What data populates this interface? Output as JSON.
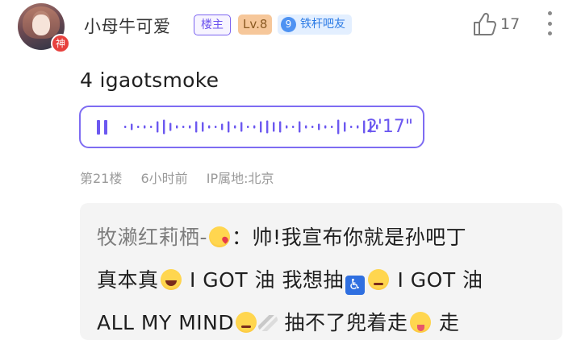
{
  "author": {
    "username": "小母牛可爱",
    "avatar_badge": "神",
    "owner_tag": "楼主",
    "level_tag": "Lv.8",
    "fan_level": "9",
    "fan_title": "铁杆吧友"
  },
  "actions": {
    "like_count": "17",
    "like_icon": "thumbs-up-icon",
    "more_icon": "more-vertical-icon"
  },
  "post": {
    "text": "4 igaotsmoke",
    "voice": {
      "duration": "2'17\"",
      "state_icon": "pause-icon",
      "accent_color": "#6c58f0"
    },
    "floor": "第21楼",
    "time": "6小时前",
    "ip": "IP属地:北京"
  },
  "reply": {
    "author": "牧濑红莉栖-",
    "colon": "：",
    "line1_text": "帅!我宣布你就是孙吧丁",
    "line2_a": "真本真",
    "line2_b": " I GOT 油 我想抽",
    "line2_c": " I GOT 油",
    "line3_a": "ALL MY MIND",
    "line3_b": " 抽不了兜着走",
    "line3_c": " 走"
  }
}
